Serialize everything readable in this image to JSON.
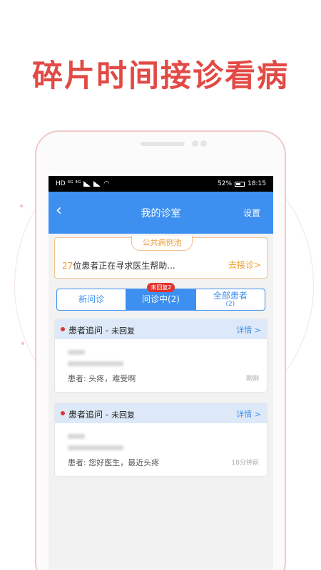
{
  "headline": "碎片时间接诊看病",
  "statusbar": {
    "left_icons": "HD ⁴ᴳ ⁴ᴳ",
    "battery": "52%",
    "time": "18:15"
  },
  "navbar": {
    "back_icon": "chevron-left-icon",
    "title": "我的诊室",
    "settings": "设置"
  },
  "pool": {
    "tag": "公共病例池",
    "count": "27",
    "text": "位患者正在寻求医生帮助...",
    "link": "去接诊>"
  },
  "tabs": [
    {
      "label": "新问诊",
      "active": false
    },
    {
      "label": "问诊中(2)",
      "active": true,
      "badge": "未回复2"
    },
    {
      "label": "全部患者",
      "sub": "(2)",
      "active": false
    }
  ],
  "cards": [
    {
      "title": "患者追问 - ",
      "status": "未回复",
      "detail": "详情 >",
      "message": "患者: 头疼，难受啊",
      "time": "刚刚"
    },
    {
      "title": "患者追问 - ",
      "status": "未回复",
      "detail": "详情 >",
      "message": "患者: 您好医生，最近头疼",
      "time": "18分钟前"
    }
  ],
  "colors": {
    "headline": "#e24a45",
    "primary": "#3d8ff0",
    "accent": "#f29a2e",
    "alert": "#e0342d"
  }
}
